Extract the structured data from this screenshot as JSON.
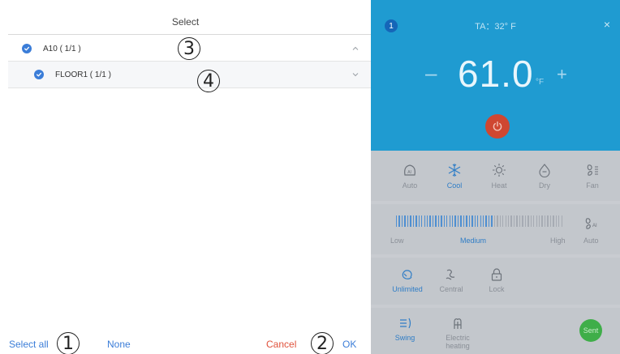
{
  "select_panel": {
    "title": "Select",
    "rows": [
      {
        "label": "A10 ( 1/1 )",
        "checked": true,
        "expanded": true
      },
      {
        "label": "FLOOR1 ( 1/1 )",
        "checked": true,
        "expanded": false
      }
    ],
    "footer": {
      "select_all": "Select all",
      "none": "None",
      "cancel": "Cancel",
      "ok": "OK"
    },
    "annotations": [
      "1",
      "2",
      "3",
      "4"
    ]
  },
  "control_panel": {
    "badge": "1",
    "ta_label": "TA：32° F",
    "close": "×",
    "minus": "–",
    "temperature": "61.0",
    "unit": "°F",
    "plus": "+",
    "modes": [
      {
        "label": "Auto",
        "icon": "auto-mode-icon",
        "active": false
      },
      {
        "label": "Cool",
        "icon": "snowflake-icon",
        "active": true
      },
      {
        "label": "Heat",
        "icon": "sun-icon",
        "active": false
      },
      {
        "label": "Dry",
        "icon": "droplet-icon",
        "active": false
      },
      {
        "label": "Fan",
        "icon": "fan-icon",
        "active": false
      }
    ],
    "fan_speed": {
      "low": "Low",
      "medium": "Medium",
      "high": "High",
      "auto": "Auto",
      "level_fraction": 0.58
    },
    "modes2": [
      {
        "label": "Unlimited",
        "icon": "unlimited-icon",
        "active": true
      },
      {
        "label": "Central",
        "icon": "central-icon",
        "active": false
      },
      {
        "label": "Lock",
        "icon": "lock-icon",
        "active": false
      }
    ],
    "extras": [
      {
        "label": "Swing",
        "icon": "swing-icon",
        "active": true
      },
      {
        "label": "Electric heating",
        "icon": "electric-heating-icon",
        "active": false
      }
    ],
    "send": "Sent"
  },
  "colors": {
    "accent": "#3b7dd8",
    "cancel": "#e0523c",
    "hero": "#1f9bd1",
    "power": "#cf4731",
    "send": "#3fae49"
  }
}
